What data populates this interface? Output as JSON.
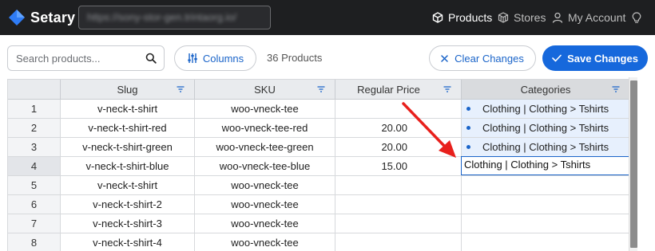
{
  "app": {
    "name": "Setary",
    "store_url": "https://sony-stor-gen.trintaorg.io/"
  },
  "nav": {
    "products": "Products",
    "stores": "Stores",
    "account": "My Account"
  },
  "toolbar": {
    "search_placeholder": "Search products...",
    "columns_label": "Columns",
    "product_count": "36 Products",
    "clear_label": "Clear Changes",
    "save_label": "Save Changes"
  },
  "columns": [
    "Slug",
    "SKU",
    "Regular Price",
    "Categories"
  ],
  "rows": [
    {
      "num": "1",
      "slug": "v-neck-t-shirt",
      "sku": "woo-vneck-tee",
      "price": "",
      "categories": "Clothing | Clothing > Tshirts"
    },
    {
      "num": "2",
      "slug": "v-neck-t-shirt-red",
      "sku": "woo-vneck-tee-red",
      "price": "20.00",
      "categories": "Clothing | Clothing > Tshirts"
    },
    {
      "num": "3",
      "slug": "v-neck-t-shirt-green",
      "sku": "woo-vneck-tee-green",
      "price": "20.00",
      "categories": "Clothing | Clothing > Tshirts"
    },
    {
      "num": "4",
      "slug": "v-neck-t-shirt-blue",
      "sku": "woo-vneck-tee-blue",
      "price": "15.00",
      "categories": "Clothing | Clothing > Tshirts"
    },
    {
      "num": "5",
      "slug": "v-neck-t-shirt",
      "sku": "woo-vneck-tee",
      "price": "",
      "categories": ""
    },
    {
      "num": "6",
      "slug": "v-neck-t-shirt-2",
      "sku": "woo-vneck-tee",
      "price": "",
      "categories": ""
    },
    {
      "num": "7",
      "slug": "v-neck-t-shirt-3",
      "sku": "woo-vneck-tee",
      "price": "",
      "categories": ""
    },
    {
      "num": "8",
      "slug": "v-neck-t-shirt-4",
      "sku": "woo-vneck-tee",
      "price": "",
      "categories": ""
    }
  ],
  "colors": {
    "topbar": "#1e1f21",
    "accent": "#1668dc",
    "selection": "#e7f0fd",
    "annotation_arrow": "#e8201c"
  },
  "icons": [
    "logo-icon",
    "products-cube-icon",
    "stores-cubes-icon",
    "account-person-icon",
    "lightbulb-icon",
    "search-icon",
    "columns-sliders-icon",
    "close-icon",
    "check-icon",
    "filter-icon"
  ]
}
